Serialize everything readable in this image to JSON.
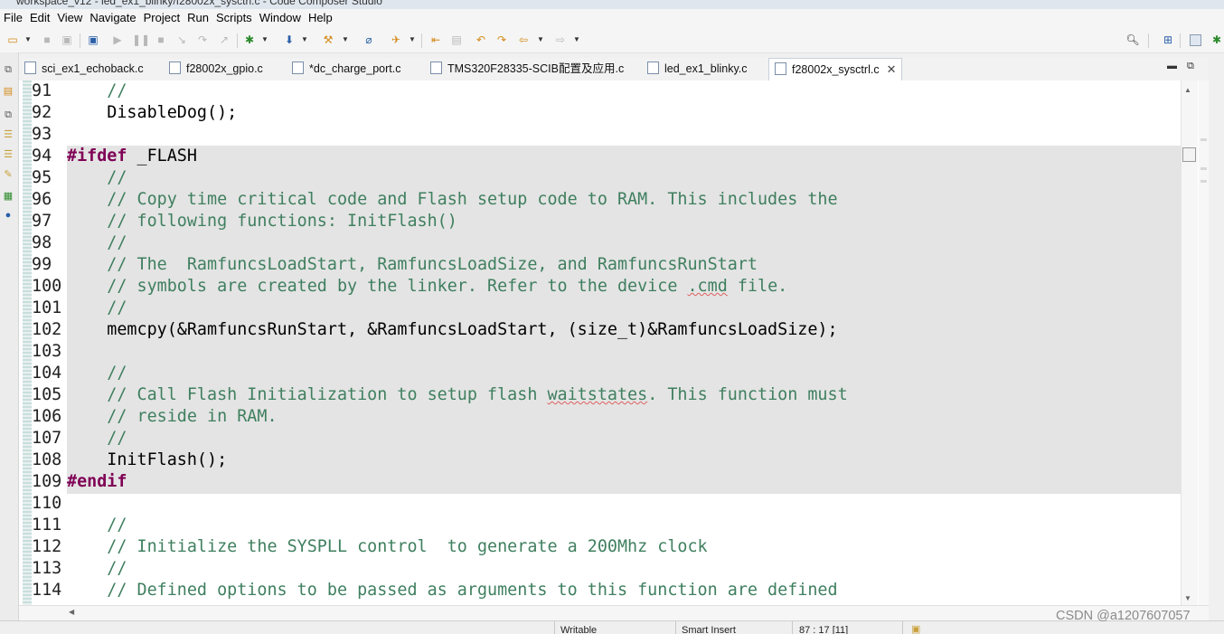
{
  "window": {
    "title": "workspace_v12 - led_ex1_blinky/f28002x_sysctrl.c - Code Composer Studio"
  },
  "menu": [
    "File",
    "Edit",
    "View",
    "Navigate",
    "Project",
    "Run",
    "Scripts",
    "Window",
    "Help"
  ],
  "toolbar": {
    "icons": [
      "new-icon",
      "save-icon",
      "save-all-icon",
      "debug-view-icon",
      "resume-icon",
      "suspend-icon",
      "terminate-icon",
      "step-into-icon",
      "step-over-icon",
      "step-return-icon",
      "debug-icon",
      "build-icon",
      "hammer-icon",
      "search-refs-icon",
      "external-tools-icon",
      "prev-annotation-icon",
      "next-annotation-icon",
      "last-edit-icon",
      "back-icon",
      "forward-icon",
      "search-icon",
      "open-perspective-icon",
      "ccs-edit-perspective-icon",
      "debug-perspective-icon"
    ]
  },
  "tabs": [
    {
      "label": "sci_ex1_echoback.c",
      "active": false
    },
    {
      "label": "f28002x_gpio.c",
      "active": false
    },
    {
      "label": "*dc_charge_port.c",
      "active": false
    },
    {
      "label": "TMS320F28335-SCIB配置及应用.c",
      "active": false
    },
    {
      "label": "led_ex1_blinky.c",
      "active": false
    },
    {
      "label": "f28002x_sysctrl.c",
      "active": true
    }
  ],
  "editor": {
    "highlight_from_line": 94,
    "highlight_to_line": 109,
    "lines": [
      {
        "num": "91",
        "text": "    //"
      },
      {
        "num": "92",
        "text": "    DisableDog();"
      },
      {
        "num": "93",
        "text": ""
      },
      {
        "num": "94",
        "text": "#ifdef _FLASH"
      },
      {
        "num": "95",
        "text": "    //"
      },
      {
        "num": "96",
        "text": "    // Copy time critical code and Flash setup code to RAM. This includes the"
      },
      {
        "num": "97",
        "text": "    // following functions: InitFlash()"
      },
      {
        "num": "98",
        "text": "    //"
      },
      {
        "num": "99",
        "text": "    // The  RamfuncsLoadStart, RamfuncsLoadSize, and RamfuncsRunStart"
      },
      {
        "num": "100",
        "text": "    // symbols are created by the linker. Refer to the device .cmd file."
      },
      {
        "num": "101",
        "text": "    //"
      },
      {
        "num": "102",
        "text": "    memcpy(&RamfuncsRunStart, &RamfuncsLoadStart, (size_t)&RamfuncsLoadSize);"
      },
      {
        "num": "103",
        "text": ""
      },
      {
        "num": "104",
        "text": "    //"
      },
      {
        "num": "105",
        "text": "    // Call Flash Initialization to setup flash waitstates. This function must"
      },
      {
        "num": "106",
        "text": "    // reside in RAM."
      },
      {
        "num": "107",
        "text": "    //"
      },
      {
        "num": "108",
        "text": "    InitFlash();"
      },
      {
        "num": "109",
        "text": "#endif"
      },
      {
        "num": "110",
        "text": ""
      },
      {
        "num": "111",
        "text": "    //"
      },
      {
        "num": "112",
        "text": "    // Initialize the SYSPLL control  to generate a 200Mhz clock"
      },
      {
        "num": "113",
        "text": "    //"
      },
      {
        "num": "114",
        "text": "    // Defined options to be passed as arguments to this function are defined"
      }
    ]
  },
  "status": {
    "writable": "Writable",
    "insert_mode": "Smart Insert",
    "position": "87 : 17 [11]"
  },
  "watermark": "CSDN @a1207607057",
  "colors": {
    "comment": "#3f7f5f",
    "keyword": "#7f0055",
    "highlight": "#e4e4e4"
  }
}
